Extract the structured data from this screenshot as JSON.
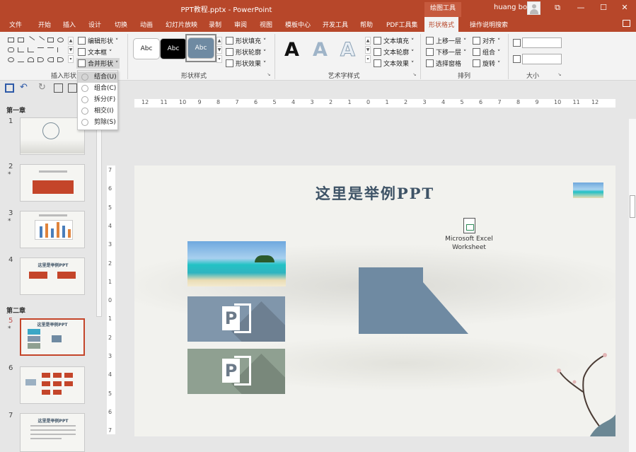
{
  "titlebar": {
    "doc_title": "PPT教程.pptx  -  PowerPoint",
    "context_group": "绘图工具",
    "user": "huang bo",
    "restore_glyph": "⧉",
    "minimize_glyph": "—",
    "maximize_glyph": "☐",
    "close_glyph": "✕"
  },
  "tabs": [
    "文件",
    "开始",
    "插入",
    "设计",
    "切换",
    "动画",
    "幻灯片放映",
    "录制",
    "审阅",
    "视图",
    "模板中心",
    "开发工具",
    "帮助",
    "PDF工具集",
    "形状格式"
  ],
  "active_tab": "形状格式",
  "tell_me": "操作说明搜索",
  "ribbon": {
    "insert_shapes": {
      "label": "插入形状",
      "edit_shape": "编辑形状 ˅",
      "text_box": "文本框 ˅",
      "merge_shapes": "合并形状 ˅"
    },
    "shape_styles": {
      "label": "形状样式",
      "thumbs": [
        "Abc",
        "Abc",
        "Abc"
      ],
      "fill": "形状填充 ˅",
      "outline": "形状轮廓 ˅",
      "effects": "形状效果 ˅"
    },
    "wordart": {
      "label": "艺术字样式",
      "samples": [
        "A",
        "A",
        "A"
      ],
      "text_fill": "文本填充 ˅",
      "text_outline": "文本轮廓 ˅",
      "text_effects": "文本效果 ˅"
    },
    "arrange": {
      "label": "排列",
      "bring_forward": "上移一层 ˅",
      "send_backward": "下移一层 ˅",
      "selection_pane": "选择窗格",
      "align": "对齐 ˅",
      "group": "组合 ˅",
      "rotate": "旋转 ˅"
    },
    "size": {
      "label": "大小",
      "height_value": "",
      "width_value": ""
    }
  },
  "merge_menu": {
    "items": [
      "结合(U)",
      "组合(C)",
      "拆分(F)",
      "相交(I)",
      "剪除(S)"
    ],
    "hover_index": 0
  },
  "slide_panel": {
    "sections": [
      "第一章",
      "第二章"
    ],
    "slides": [
      {
        "num": "1",
        "star": ""
      },
      {
        "num": "2",
        "star": "*"
      },
      {
        "num": "3",
        "star": "*"
      },
      {
        "num": "4",
        "star": ""
      },
      {
        "num": "5",
        "star": "*"
      },
      {
        "num": "6",
        "star": ""
      },
      {
        "num": "7",
        "star": ""
      }
    ],
    "active_slide": "5",
    "thumb4_title": "这里是举例PPT",
    "thumb5_title": "这里是举例PPT",
    "thumb7_title": "这里是举例PPT"
  },
  "ruler": {
    "horizontal": [
      "12",
      "11",
      "10",
      "9",
      "8",
      "7",
      "6",
      "5",
      "4",
      "3",
      "2",
      "1",
      "0",
      "1",
      "2",
      "3",
      "4",
      "5",
      "6",
      "7",
      "8",
      "9",
      "10",
      "11",
      "12"
    ],
    "vertical": [
      "7",
      "6",
      "5",
      "4",
      "3",
      "2",
      "1",
      "0",
      "1",
      "2",
      "3",
      "4",
      "5",
      "6",
      "7"
    ]
  },
  "slide": {
    "title": "这里是举例PPT",
    "excel_label_1": "Microsoft Excel",
    "excel_label_2": "Worksheet",
    "ppt_logo_letter": "P",
    "shape_color": "#6f8aa2",
    "card1_color": "#8096ab",
    "card2_color": "#8fa091"
  },
  "colors": {
    "accent": "#b7472a",
    "ribbon_bg": "#f3f3f3",
    "title_text": "#3e5366"
  }
}
